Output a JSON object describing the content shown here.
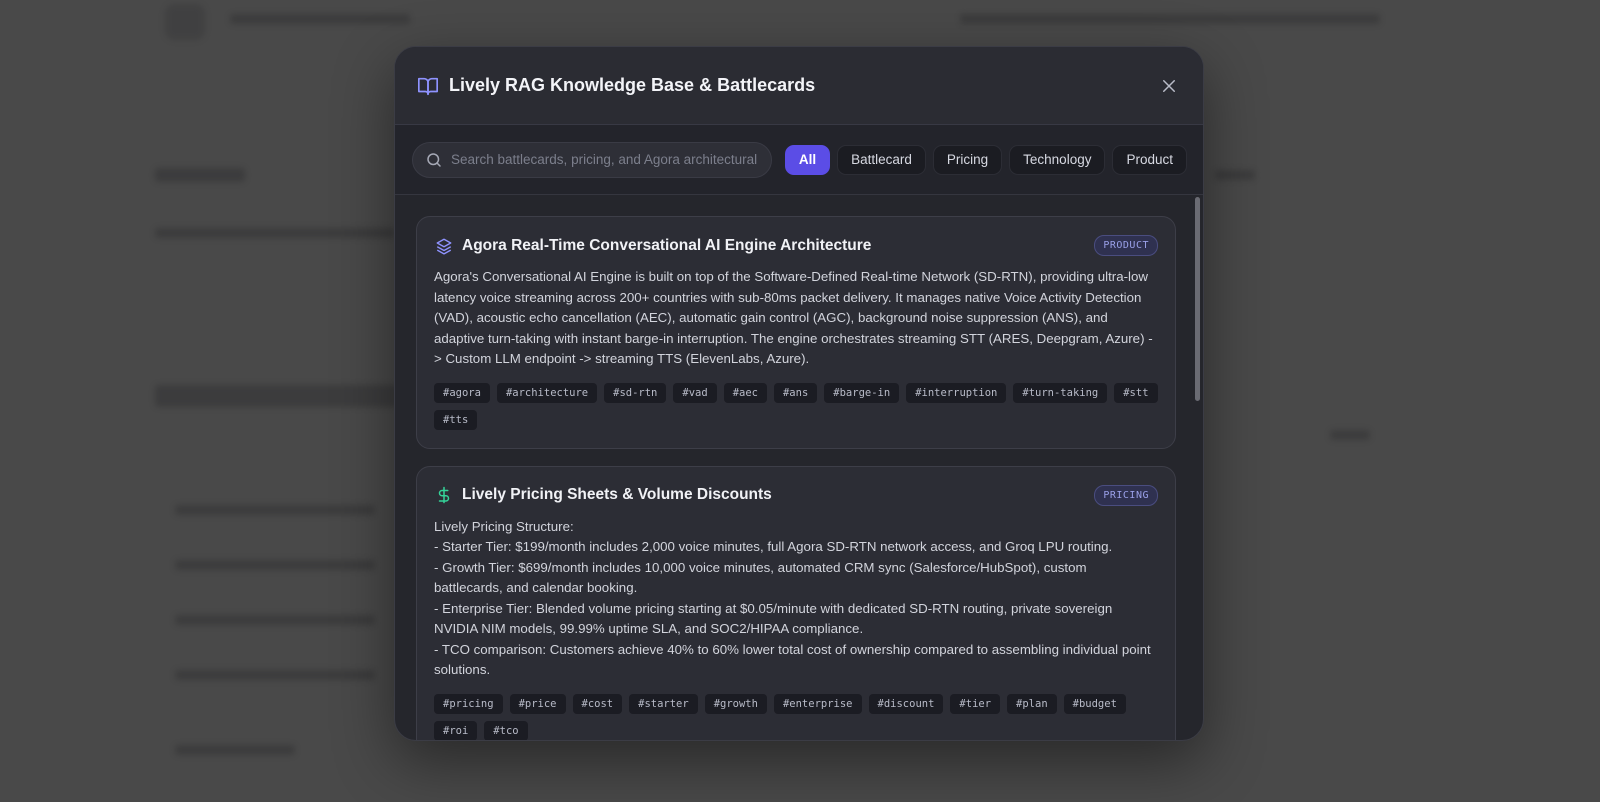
{
  "modal": {
    "title": "Lively RAG Knowledge Base & Battlecards",
    "search_placeholder": "Search battlecards, pricing, and Agora architectural sp",
    "filters": [
      {
        "label": "All",
        "active": true
      },
      {
        "label": "Battlecard",
        "active": false
      },
      {
        "label": "Pricing",
        "active": false
      },
      {
        "label": "Technology",
        "active": false
      },
      {
        "label": "Product",
        "active": false
      }
    ],
    "accent_color": "#5b4de6"
  },
  "cards": [
    {
      "icon": "layers-icon",
      "title": "Agora Real-Time Conversational AI Engine Architecture",
      "badge": "PRODUCT",
      "body": "Agora's Conversational AI Engine is built on top of the Software-Defined Real-time Network (SD-RTN), providing ultra-low latency voice streaming across 200+ countries with sub-80ms packet delivery. It manages native Voice Activity Detection (VAD), acoustic echo cancellation (AEC), automatic gain control (AGC), background noise suppression (ANS), and adaptive turn-taking with instant barge-in interruption. The engine orchestrates streaming STT (ARES, Deepgram, Azure) -> Custom LLM endpoint -> streaming TTS (ElevenLabs, Azure).",
      "tags": [
        "#agora",
        "#architecture",
        "#sd-rtn",
        "#vad",
        "#aec",
        "#ans",
        "#barge-in",
        "#interruption",
        "#turn-taking",
        "#stt",
        "#tts"
      ]
    },
    {
      "icon": "dollar-icon",
      "title": "Lively Pricing Sheets & Volume Discounts",
      "badge": "PRICING",
      "body": "Lively Pricing Structure:\n- Starter Tier: $199/month includes 2,000 voice minutes, full Agora SD-RTN network access, and Groq LPU routing.\n- Growth Tier: $699/month includes 10,000 voice minutes, automated CRM sync (Salesforce/HubSpot), custom battlecards, and calendar booking.\n- Enterprise Tier: Blended volume pricing starting at $0.05/minute with dedicated SD-RTN routing, private sovereign NVIDIA NIM models, 99.99% uptime SLA, and SOC2/HIPAA compliance.\n- TCO comparison: Customers achieve 40% to 60% lower total cost of ownership compared to assembling individual point solutions.",
      "tags": [
        "#pricing",
        "#price",
        "#cost",
        "#starter",
        "#growth",
        "#enterprise",
        "#discount",
        "#tier",
        "#plan",
        "#budget",
        "#roi",
        "#tco"
      ]
    }
  ]
}
